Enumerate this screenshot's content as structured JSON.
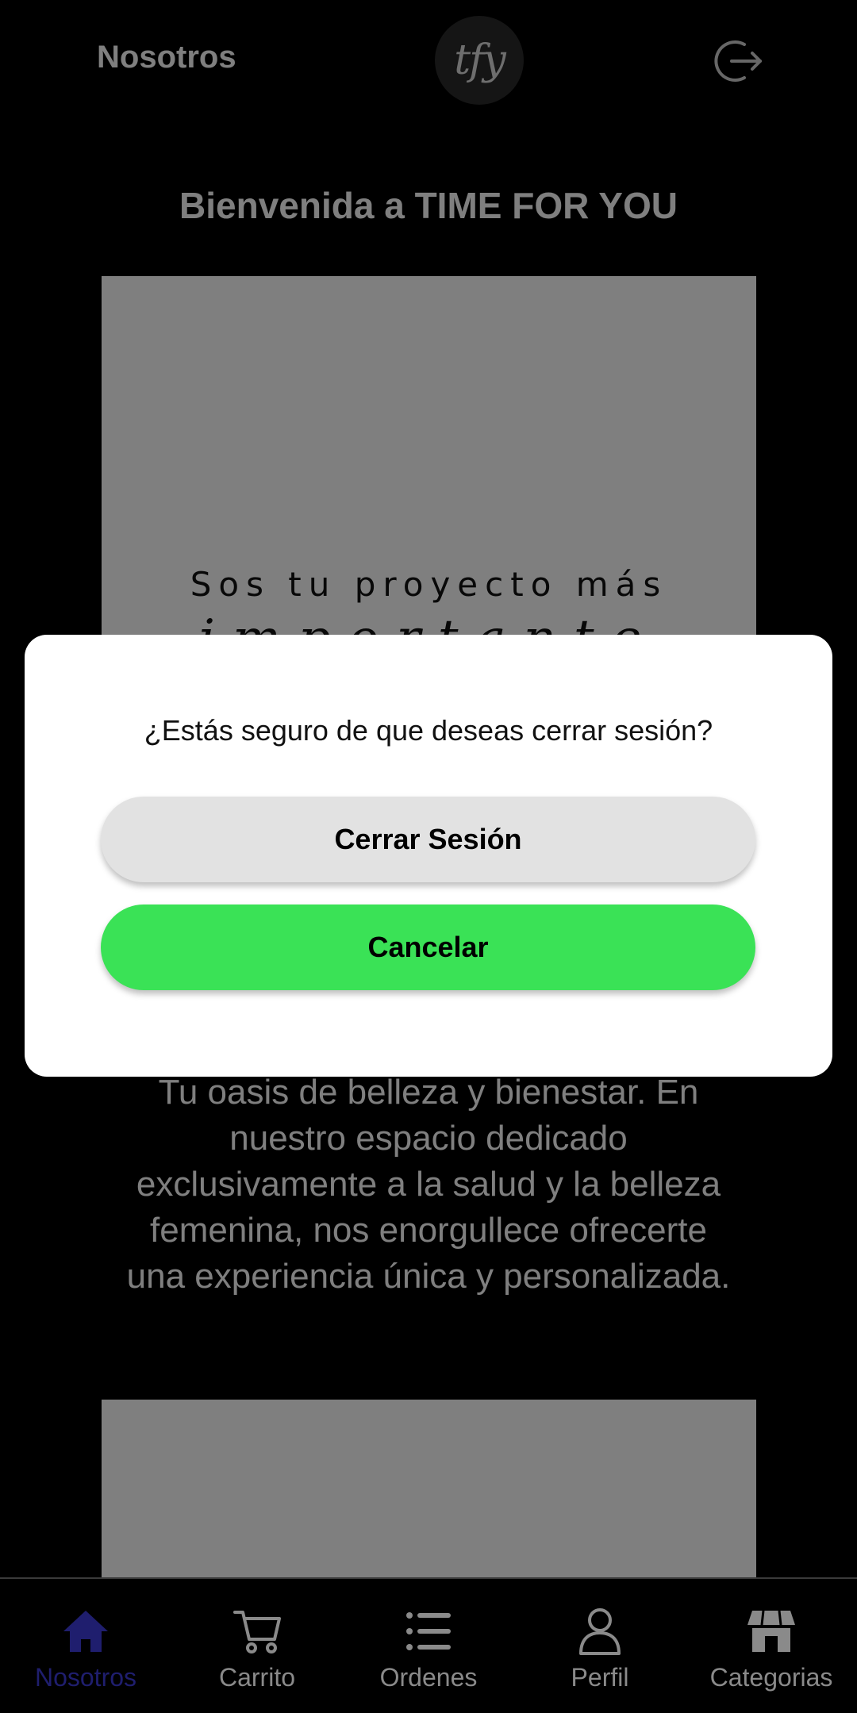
{
  "header": {
    "title": "Nosotros",
    "logo_text": "tfy"
  },
  "welcome": "Bienvenida a TIME FOR YOU",
  "hero": {
    "caption": "Sos tu proyecto más",
    "script_text": "importante"
  },
  "intro_text": "Tu oasis de belleza y bienestar. En nuestro espacio dedicado exclusivamente a la salud y la belleza femenina, nos enorgullece ofrecerte una experiencia única y personalizada.",
  "dialog": {
    "message": "¿Estás seguro de que deseas cerrar sesión?",
    "confirm_label": "Cerrar Sesión",
    "cancel_label": "Cancelar"
  },
  "bottom_nav": {
    "items": [
      {
        "label": "Nosotros",
        "icon": "home-icon",
        "active": true
      },
      {
        "label": "Carrito",
        "icon": "cart-icon"
      },
      {
        "label": "Ordenes",
        "icon": "list-icon"
      },
      {
        "label": "Perfil",
        "icon": "user-icon"
      },
      {
        "label": "Categorias",
        "icon": "store-icon"
      }
    ]
  },
  "colors": {
    "accent_green": "#3ae256",
    "active_nav": "#1f1e6e",
    "background": "#000000"
  }
}
